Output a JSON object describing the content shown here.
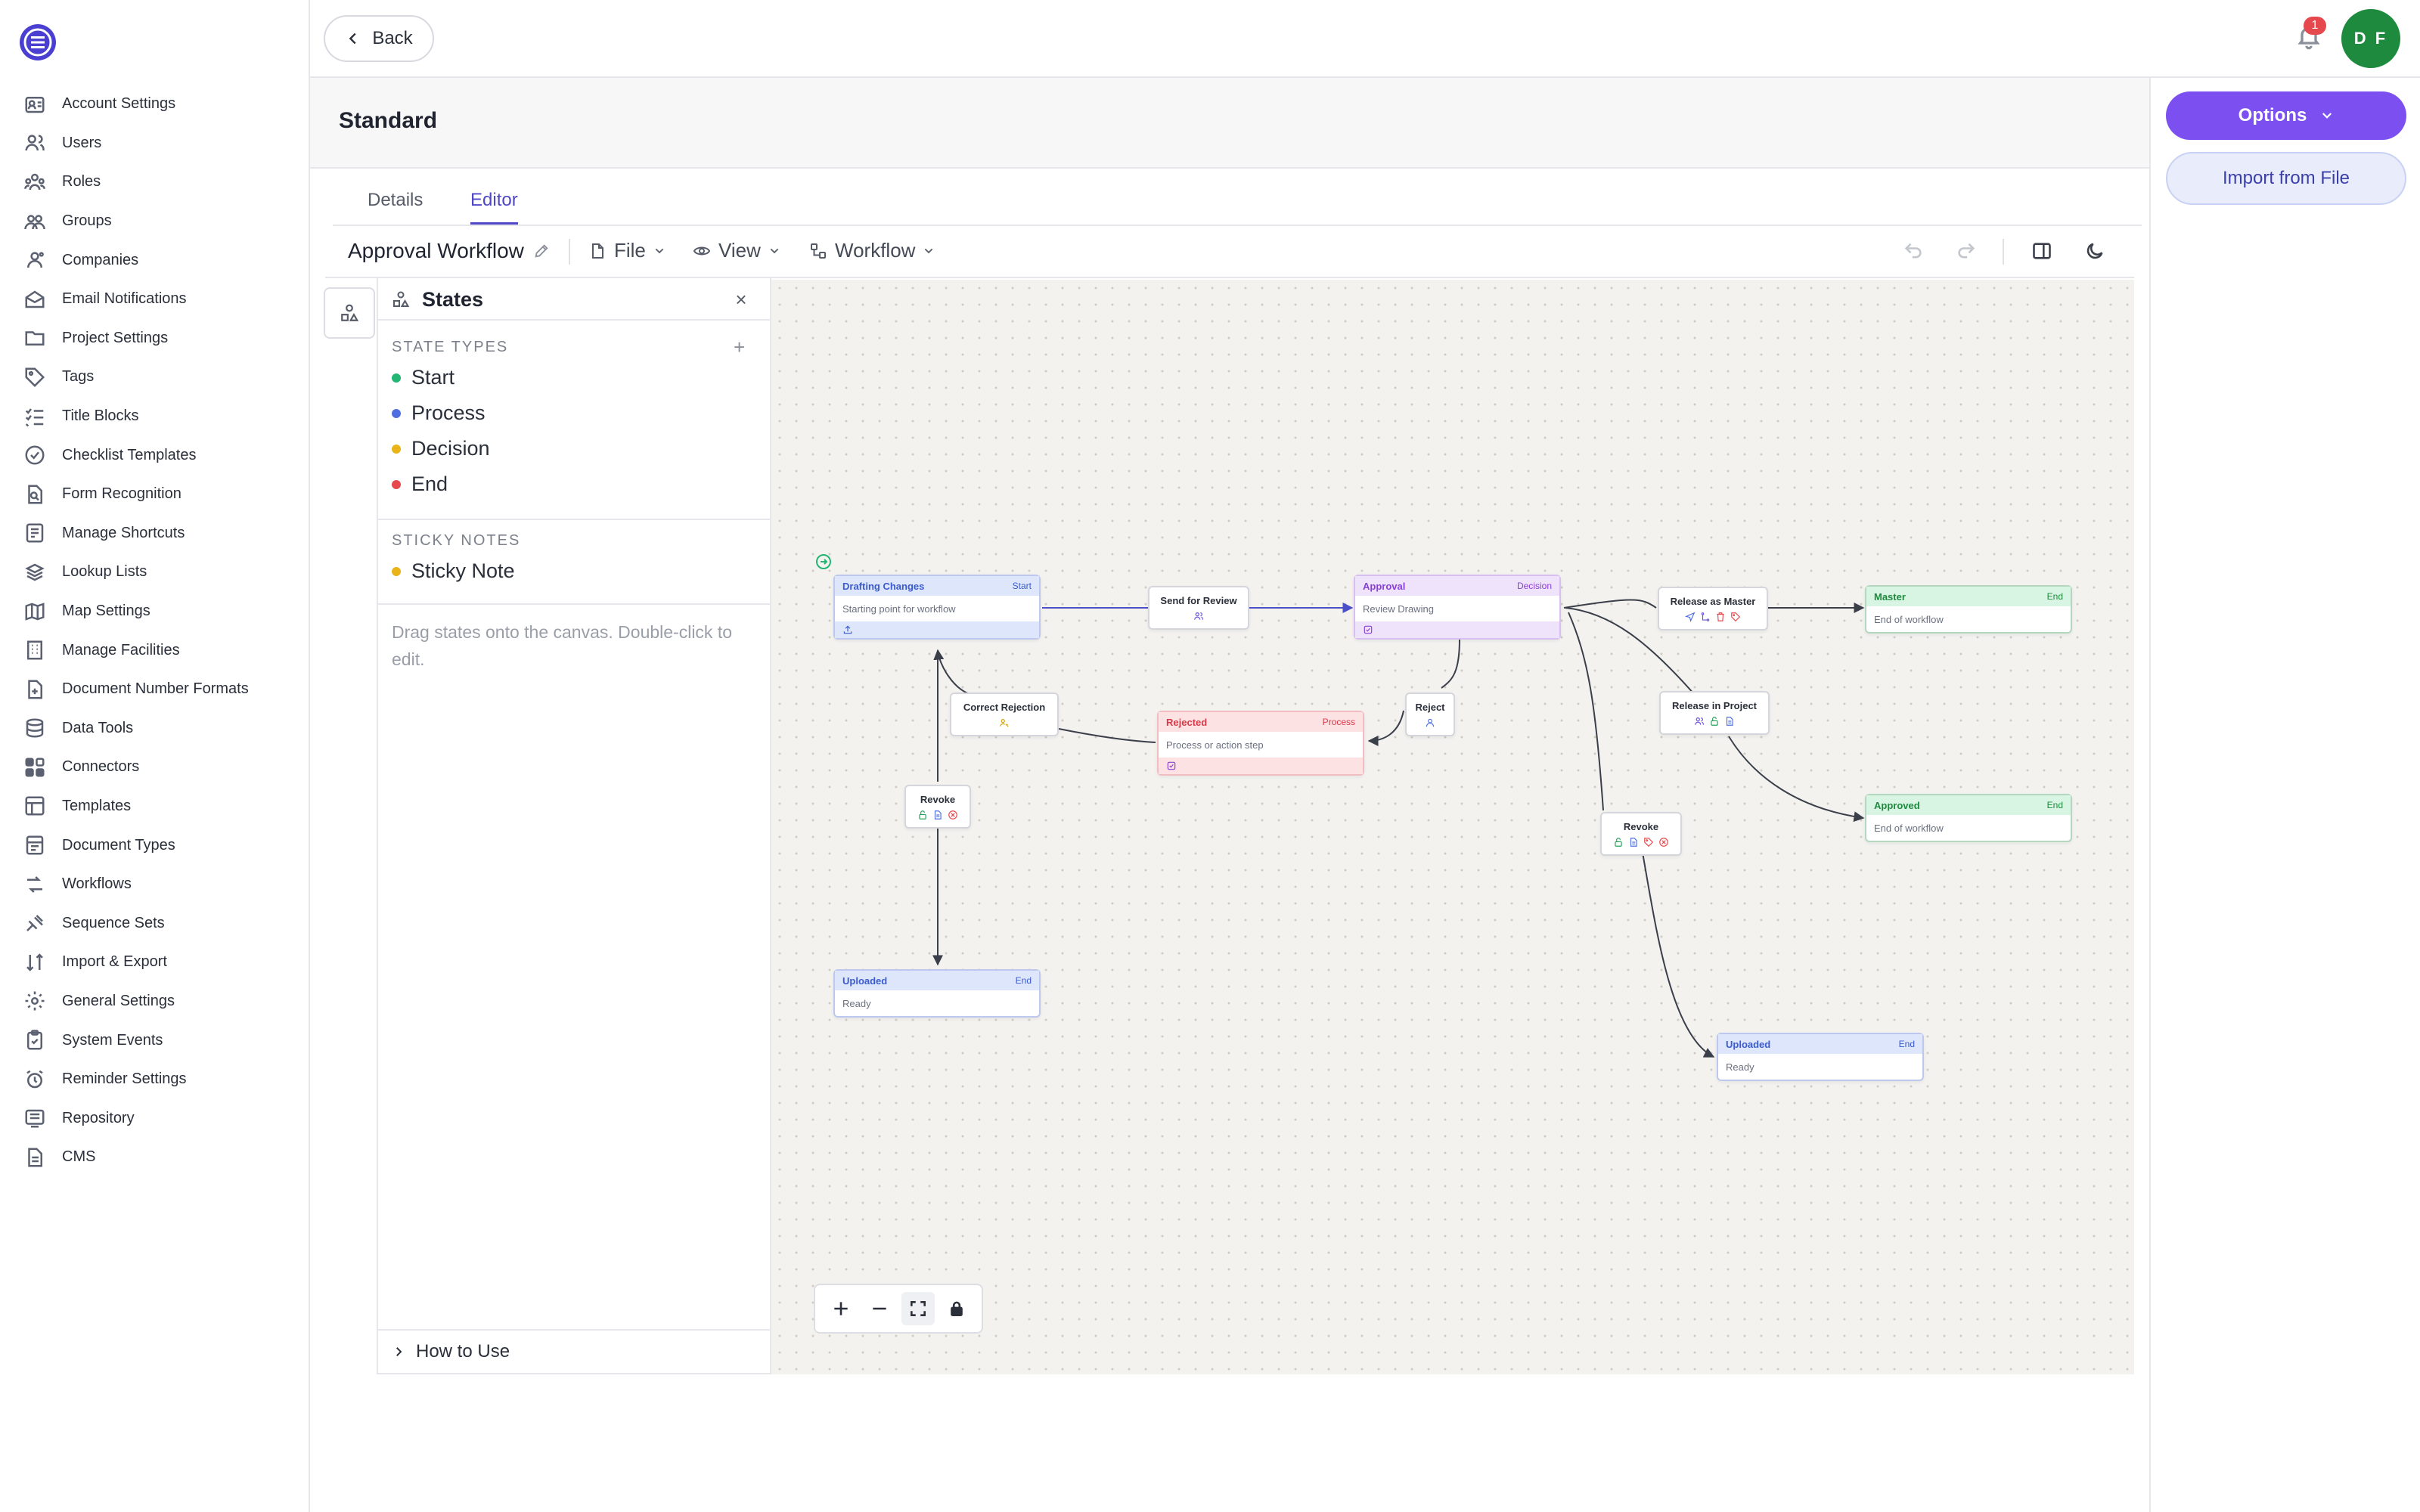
{
  "nav": [
    {
      "label": "Account Settings",
      "icon": "account-settings-icon"
    },
    {
      "label": "Users",
      "icon": "users-icon"
    },
    {
      "label": "Roles",
      "icon": "roles-icon"
    },
    {
      "label": "Groups",
      "icon": "groups-icon"
    },
    {
      "label": "Companies",
      "icon": "companies-icon"
    },
    {
      "label": "Email Notifications",
      "icon": "email-icon"
    },
    {
      "label": "Project Settings",
      "icon": "folder-icon"
    },
    {
      "label": "Tags",
      "icon": "tag-icon"
    },
    {
      "label": "Title Blocks",
      "icon": "list-check-icon"
    },
    {
      "label": "Checklist Templates",
      "icon": "check-circle-icon"
    },
    {
      "label": "Form Recognition",
      "icon": "document-search-icon"
    },
    {
      "label": "Manage Shortcuts",
      "icon": "shortcut-icon"
    },
    {
      "label": "Lookup Lists",
      "icon": "stack-icon"
    },
    {
      "label": "Map Settings",
      "icon": "map-icon"
    },
    {
      "label": "Manage Facilities",
      "icon": "building-icon"
    },
    {
      "label": "Document Number Formats",
      "icon": "document-plus-icon"
    },
    {
      "label": "Data Tools",
      "icon": "database-icon"
    },
    {
      "label": "Connectors",
      "icon": "connectors-icon"
    },
    {
      "label": "Templates",
      "icon": "template-icon"
    },
    {
      "label": "Document Types",
      "icon": "document-types-icon"
    },
    {
      "label": "Workflows",
      "icon": "workflow-icon"
    },
    {
      "label": "Sequence Sets",
      "icon": "sequence-icon"
    },
    {
      "label": "Import & Export",
      "icon": "import-export-icon"
    },
    {
      "label": "General Settings",
      "icon": "gear-icon"
    },
    {
      "label": "System Events",
      "icon": "clipboard-check-icon"
    },
    {
      "label": "Reminder Settings",
      "icon": "alarm-icon"
    },
    {
      "label": "Repository",
      "icon": "repository-icon"
    },
    {
      "label": "CMS",
      "icon": "document-icon"
    }
  ],
  "topbar": {
    "back_label": "Back",
    "notification_count": "1",
    "avatar_initials": "D F"
  },
  "header": {
    "title": "Standard"
  },
  "right_panel": {
    "options_label": "Options",
    "import_label": "Import from File"
  },
  "tabs": [
    {
      "label": "Details",
      "active": false
    },
    {
      "label": "Editor",
      "active": true
    }
  ],
  "toolbar": {
    "workflow_name": "Approval Workflow",
    "file_label": "File",
    "view_label": "View",
    "workflow_label": "Workflow"
  },
  "states_panel": {
    "title": "States",
    "state_types_label": "STATE TYPES",
    "state_types": [
      {
        "label": "Start",
        "color": "#22b573"
      },
      {
        "label": "Process",
        "color": "#4f6fe0"
      },
      {
        "label": "Decision",
        "color": "#e8b417"
      },
      {
        "label": "End",
        "color": "#e5484d"
      }
    ],
    "sticky_notes_label": "STICKY NOTES",
    "sticky_notes": [
      {
        "label": "Sticky Note",
        "color": "#e8b417"
      }
    ],
    "help_text": "Drag states onto the canvas. Double-click to edit.",
    "footer_label": "How to Use"
  },
  "canvas": {
    "nodes": [
      {
        "id": "drafting",
        "title": "Drafting Changes",
        "type": "Start",
        "body": "Starting point for workflow",
        "head_bg": "#dde6fb",
        "head_color": "#3b5bd0",
        "foot_bg": "#dde6fb",
        "foot_icons": [
          "upload-icon"
        ]
      },
      {
        "id": "approval",
        "title": "Approval",
        "type": "Decision",
        "body": "Review Drawing",
        "head_bg": "#efe3fb",
        "head_color": "#8a3fd6",
        "foot_bg": "#efe3fb",
        "foot_icons": [
          "checkbox-icon"
        ]
      },
      {
        "id": "rejected",
        "title": "Rejected",
        "type": "Process",
        "body": "Process or action step",
        "head_bg": "#fde2e4",
        "head_color": "#d63a48",
        "foot_bg": "#fde2e4",
        "foot_icons": [
          "checkbox-icon"
        ]
      },
      {
        "id": "master",
        "title": "Master",
        "type": "End",
        "body": "End of workflow",
        "head_bg": "#d8f4e2",
        "head_color": "#1e8a3e",
        "foot_bg": "",
        "foot_icons": []
      },
      {
        "id": "approved",
        "title": "Approved",
        "type": "End",
        "body": "End of workflow",
        "head_bg": "#d8f4e2",
        "head_color": "#1e8a3e",
        "foot_bg": "",
        "foot_icons": []
      },
      {
        "id": "uploaded1",
        "title": "Uploaded",
        "type": "End",
        "body": "Ready",
        "head_bg": "#dde6fb",
        "head_color": "#3b5bd0",
        "foot_bg": "",
        "foot_icons": []
      },
      {
        "id": "uploaded2",
        "title": "Uploaded",
        "type": "End",
        "body": "Ready",
        "head_bg": "#dde6fb",
        "head_color": "#3b5bd0",
        "foot_bg": "",
        "foot_icons": []
      }
    ],
    "transitions": [
      {
        "id": "send-review",
        "label": "Send for Review",
        "icons": [
          "users-icon"
        ]
      },
      {
        "id": "correct-rejection",
        "label": "Correct Rejection",
        "icons": [
          "user-key-icon"
        ]
      },
      {
        "id": "reject",
        "label": "Reject",
        "icons": [
          "user-icon"
        ]
      },
      {
        "id": "revoke1",
        "label": "Revoke",
        "icons": [
          "unlock-icon",
          "document-icon",
          "cancel-icon"
        ]
      },
      {
        "id": "release-master",
        "label": "Release as Master",
        "icons": [
          "send-icon",
          "branch-icon",
          "trash-icon",
          "tag-icon"
        ]
      },
      {
        "id": "release-project",
        "label": "Release in Project",
        "icons": [
          "users-icon",
          "unlock-icon",
          "document-icon"
        ]
      },
      {
        "id": "revoke2",
        "label": "Revoke",
        "icons": [
          "unlock-icon",
          "document-icon",
          "tag-icon",
          "cancel-icon"
        ]
      }
    ]
  },
  "colors": {
    "accent": "#7b4ff0",
    "tab_active": "#4f46c8",
    "avatar": "#1e8a3e",
    "badge": "#e5484d"
  }
}
